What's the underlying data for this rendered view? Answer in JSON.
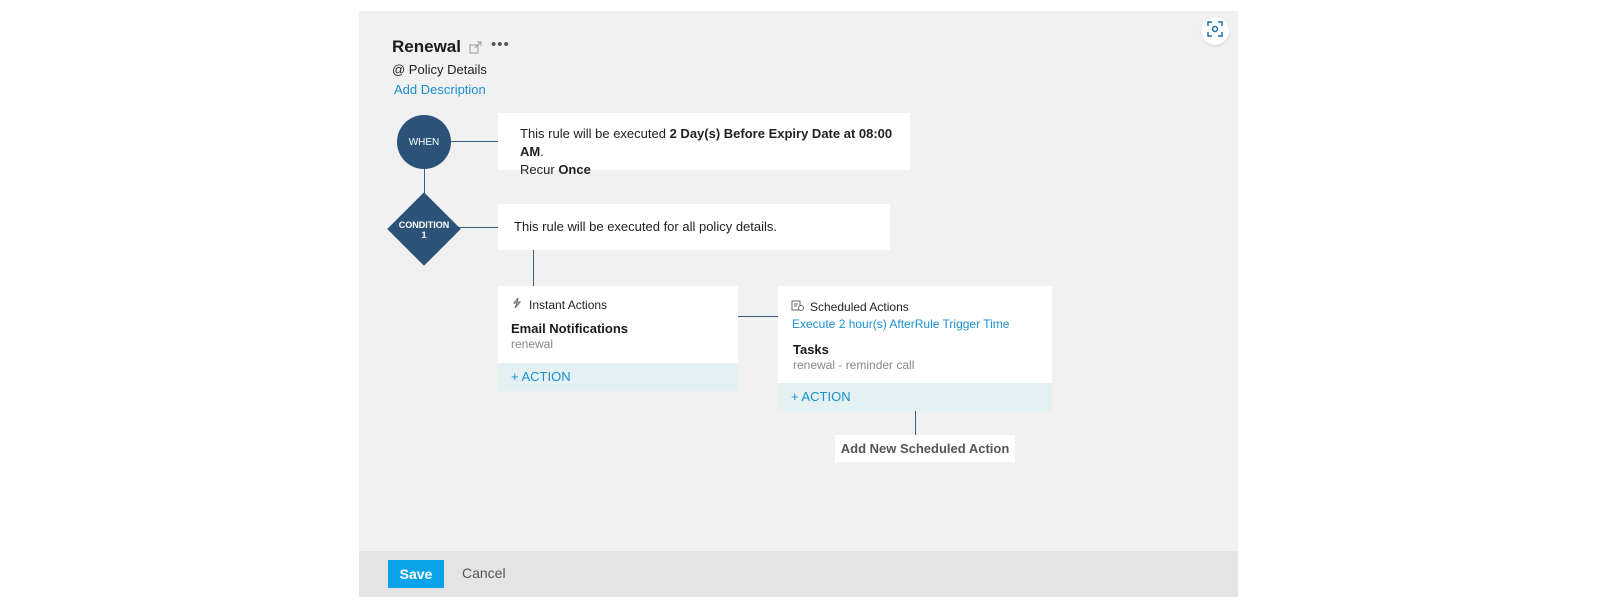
{
  "rule": {
    "title": "Renewal",
    "module": "@ Policy Details",
    "add_description": "Add Description"
  },
  "when": {
    "label": "WHEN",
    "text_prefix": "This rule will be executed",
    "text_bold": "2 Day(s) Before Expiry Date at 08:00 AM",
    "text_suffix": ".",
    "recur_label": "Recur",
    "recur_value": "Once"
  },
  "condition": {
    "label_line1": "CONDITION",
    "label_line2": "1",
    "text": "This rule will be executed for all policy details."
  },
  "instant_actions": {
    "header": "Instant Actions",
    "type": "Email Notifications",
    "value": "renewal",
    "add_action": "+ ACTION"
  },
  "scheduled_actions": {
    "header": "Scheduled Actions",
    "execute_link": "Execute 2 hour(s) AfterRule Trigger Time",
    "type": "Tasks",
    "value": "renewal - reminder call",
    "add_action": "+ ACTION",
    "add_new": "Add New Scheduled Action"
  },
  "footer": {
    "save": "Save",
    "cancel": "Cancel"
  },
  "colors": {
    "node": "#2c5377",
    "link": "#1a8fd1",
    "save": "#0ca4e8"
  }
}
